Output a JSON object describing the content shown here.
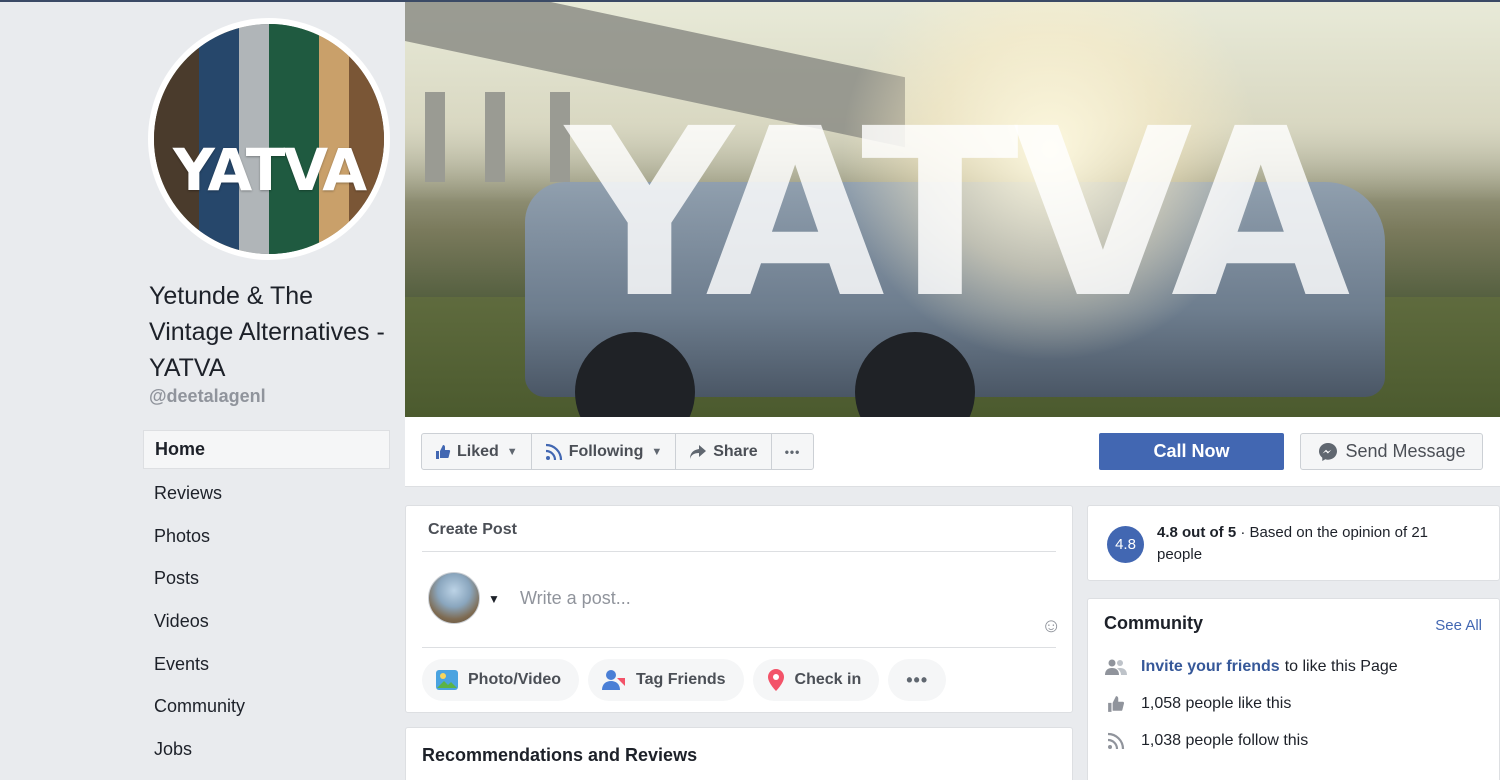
{
  "page": {
    "name": "Yetunde & The Vintage Alternatives - YATVA",
    "handle": "@deetalagenl",
    "avatar_text": "YATVA",
    "cover_text": "YATVA"
  },
  "nav": {
    "items": [
      {
        "label": "Home",
        "active": true
      },
      {
        "label": "Reviews"
      },
      {
        "label": "Photos"
      },
      {
        "label": "Posts"
      },
      {
        "label": "Videos"
      },
      {
        "label": "Events"
      },
      {
        "label": "Community"
      },
      {
        "label": "Jobs"
      }
    ]
  },
  "actions": {
    "liked": "Liked",
    "following": "Following",
    "share": "Share",
    "more": "•••",
    "call_now": "Call Now",
    "send_message": "Send Message"
  },
  "create_post": {
    "title": "Create Post",
    "placeholder": "Write a post...",
    "buttons": {
      "photo_video": "Photo/Video",
      "tag_friends": "Tag Friends",
      "check_in": "Check in",
      "more": "•••"
    }
  },
  "reviews": {
    "title": "Recommendations and Reviews"
  },
  "rating": {
    "badge": "4.8",
    "score": "4.8 out of 5",
    "separator": " · ",
    "description": "Based on the opinion of 21 people"
  },
  "community": {
    "title": "Community",
    "see_all": "See All",
    "invite_link": "Invite your friends",
    "invite_suffix": "to like this Page",
    "likes": "1,058 people like this",
    "follows": "1,038 people follow this"
  },
  "colors": {
    "brand_blue": "#4267b2",
    "link_blue": "#365899",
    "background": "#e9ebee"
  }
}
